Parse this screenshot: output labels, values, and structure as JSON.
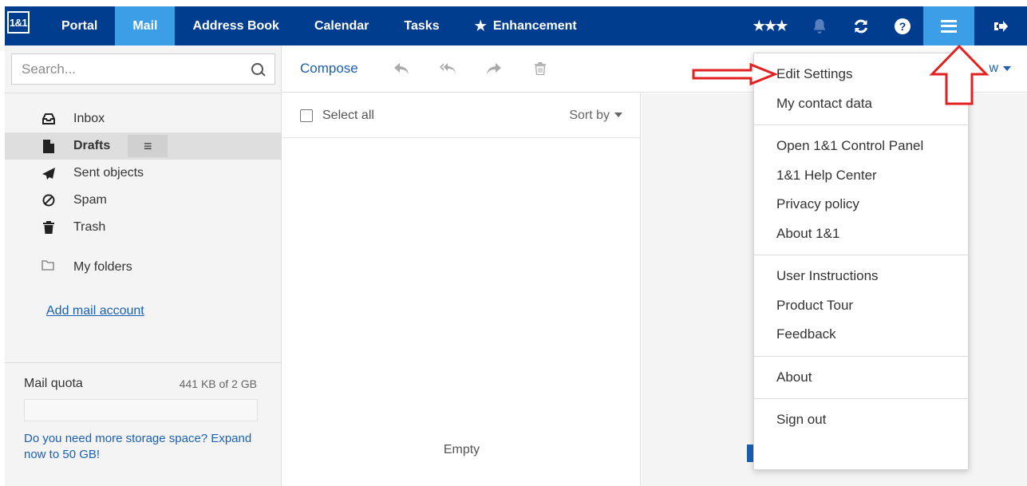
{
  "nav": {
    "logo": "1&1",
    "tabs": [
      {
        "label": "Portal",
        "active": false
      },
      {
        "label": "Mail",
        "active": true
      },
      {
        "label": "Address Book",
        "active": false
      },
      {
        "label": "Calendar",
        "active": false
      },
      {
        "label": "Tasks",
        "active": false
      },
      {
        "label": "Enhancement",
        "active": false,
        "icon": "star-icon"
      }
    ],
    "rating_stars": "★★★",
    "right_icons": [
      "stars-rating-icon",
      "bell-icon",
      "refresh-icon",
      "help-icon",
      "menu-icon",
      "logout-icon"
    ]
  },
  "sidebar": {
    "search_placeholder": "Search...",
    "folders": [
      {
        "label": "Inbox",
        "icon": "inbox-icon"
      },
      {
        "label": "Drafts",
        "icon": "draft-file-icon",
        "active": true
      },
      {
        "label": "Sent objects",
        "icon": "paper-plane-icon"
      },
      {
        "label": "Spam",
        "icon": "ban-icon"
      },
      {
        "label": "Trash",
        "icon": "trash-icon"
      }
    ],
    "my_folders": "My folders",
    "add_mail_account": "Add mail account",
    "quota": {
      "label": "Mail quota",
      "value": "441 KB of 2 GB",
      "fill_percent": 0.02
    },
    "storage_upsell": "Do you need more storage space? Expand now to 50 GB!"
  },
  "toolbar": {
    "compose": "Compose",
    "view_label": "w"
  },
  "mail_list": {
    "select_all": "Select all",
    "sort_by": "Sort by",
    "empty": "Empty"
  },
  "menu": {
    "groups": [
      [
        "Edit Settings",
        "My contact data"
      ],
      [
        "Open 1&1 Control Panel",
        "1&1 Help Center",
        "Privacy policy",
        "About 1&1"
      ],
      [
        "User Instructions",
        "Product Tour",
        "Feedback"
      ],
      [
        "About"
      ],
      [
        "Sign out"
      ]
    ]
  },
  "colors": {
    "nav_bg": "#003d8f",
    "nav_active": "#3b9ee6",
    "link": "#1a5fb4",
    "annotation": "#e32020"
  }
}
